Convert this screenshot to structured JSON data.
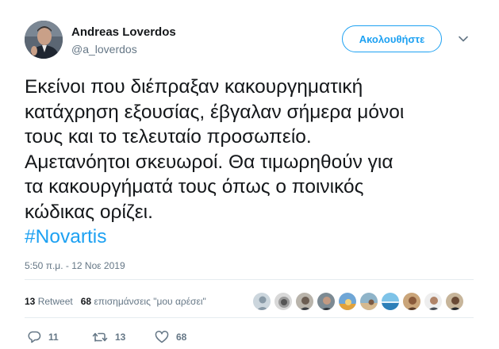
{
  "author": {
    "display_name": "Andreas Loverdos",
    "handle": "@a_loverdos"
  },
  "follow_button": {
    "label": "Ακολουθήστε"
  },
  "tweet": {
    "lines": [
      "Εκείνοι που διέπραξαν κακουργηματική",
      "κατάχρηση εξουσίας, έβγαλαν σήμερα μόνοι",
      "τους και το τελευταίο προσωπείο.",
      "Αμετανόητοι σκευωροί. Θα τιμωρηθούν για",
      "τα κακουργήματά τους όπως ο ποινικός",
      "κώδικας ορίζει."
    ],
    "hashtag": "#Novartis",
    "timestamp": "5:50 π.μ. - 12 Νοε 2019"
  },
  "stats": {
    "retweet_count": "13",
    "retweet_label": "Retweet",
    "likes_count": "68",
    "likes_label": "επισημάνσεις \"μου αρέσει\""
  },
  "actions": {
    "reply_count": "11",
    "retweet_count": "13",
    "like_count": "68"
  },
  "colors": {
    "accent": "#1da1f2",
    "muted": "#657786",
    "text": "#14171a",
    "divider": "#e6ecf0"
  },
  "icons": [
    "chevron-down-icon",
    "reply-icon",
    "retweet-icon",
    "heart-icon"
  ]
}
